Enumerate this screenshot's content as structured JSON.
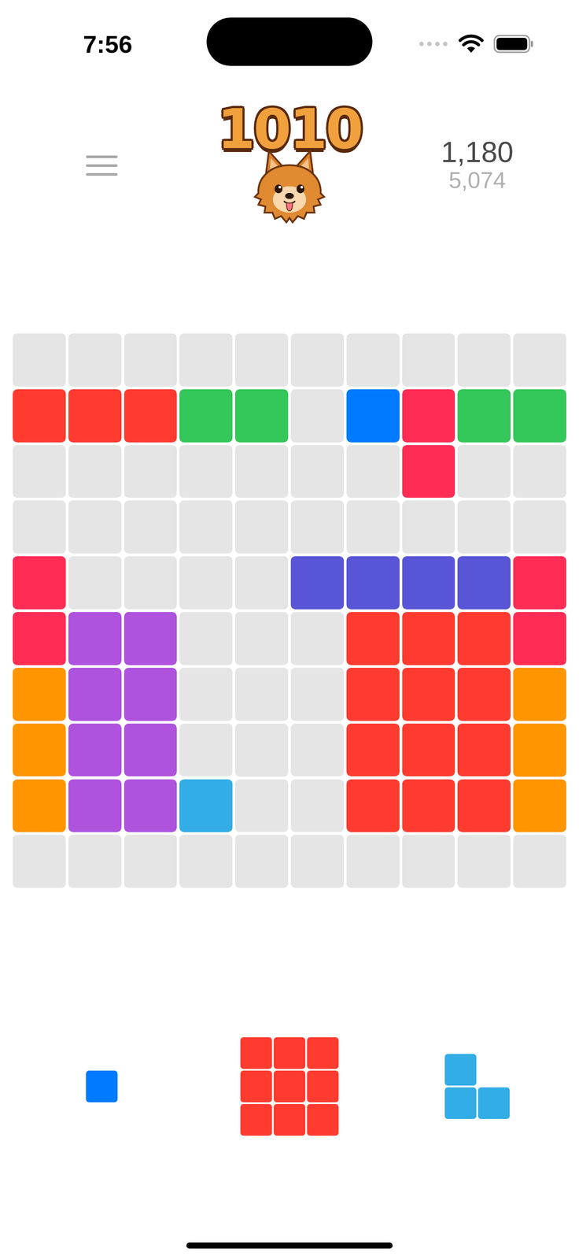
{
  "status_bar": {
    "time": "7:56"
  },
  "header": {
    "logo": "1010",
    "score": "1,180",
    "best": "5,074"
  },
  "board": {
    "rows": [
      [
        {
          "filled": false
        },
        {
          "filled": false
        },
        {
          "filled": false
        },
        {
          "filled": false
        },
        {
          "filled": false
        },
        {
          "filled": false
        },
        {
          "filled": false
        },
        {
          "filled": false
        },
        {
          "filled": false
        },
        {
          "filled": false
        }
      ],
      [
        {
          "filled": true,
          "color": "#FF3B30"
        },
        {
          "filled": true,
          "color": "#FF3B30"
        },
        {
          "filled": true,
          "color": "#FF3B30"
        },
        {
          "filled": true,
          "color": "#34C759"
        },
        {
          "filled": true,
          "color": "#34C759"
        },
        {
          "filled": false
        },
        {
          "filled": true,
          "color": "#007AFF"
        },
        {
          "filled": true,
          "color": "#FF2D55"
        },
        {
          "filled": true,
          "color": "#34C759"
        },
        {
          "filled": true,
          "color": "#34C759"
        }
      ],
      [
        {
          "filled": false
        },
        {
          "filled": false
        },
        {
          "filled": false
        },
        {
          "filled": false
        },
        {
          "filled": false
        },
        {
          "filled": false
        },
        {
          "filled": false
        },
        {
          "filled": true,
          "color": "#FF2D55"
        },
        {
          "filled": false
        },
        {
          "filled": false
        }
      ],
      [
        {
          "filled": false
        },
        {
          "filled": false
        },
        {
          "filled": false
        },
        {
          "filled": false
        },
        {
          "filled": false
        },
        {
          "filled": false
        },
        {
          "filled": false
        },
        {
          "filled": false
        },
        {
          "filled": false
        },
        {
          "filled": false
        }
      ],
      [
        {
          "filled": true,
          "color": "#FF2D55"
        },
        {
          "filled": false
        },
        {
          "filled": false
        },
        {
          "filled": false
        },
        {
          "filled": false
        },
        {
          "filled": true,
          "color": "#5856D6"
        },
        {
          "filled": true,
          "color": "#5856D6"
        },
        {
          "filled": true,
          "color": "#5856D6"
        },
        {
          "filled": true,
          "color": "#5856D6"
        },
        {
          "filled": true,
          "color": "#FF2D55"
        }
      ],
      [
        {
          "filled": true,
          "color": "#FF2D55"
        },
        {
          "filled": true,
          "color": "#AF52DE"
        },
        {
          "filled": true,
          "color": "#AF52DE"
        },
        {
          "filled": false
        },
        {
          "filled": false
        },
        {
          "filled": false
        },
        {
          "filled": true,
          "color": "#FF3B30"
        },
        {
          "filled": true,
          "color": "#FF3B30"
        },
        {
          "filled": true,
          "color": "#FF3B30"
        },
        {
          "filled": true,
          "color": "#FF2D55"
        }
      ],
      [
        {
          "filled": true,
          "color": "#FF9500"
        },
        {
          "filled": true,
          "color": "#AF52DE"
        },
        {
          "filled": true,
          "color": "#AF52DE"
        },
        {
          "filled": false
        },
        {
          "filled": false
        },
        {
          "filled": false
        },
        {
          "filled": true,
          "color": "#FF3B30"
        },
        {
          "filled": true,
          "color": "#FF3B30"
        },
        {
          "filled": true,
          "color": "#FF3B30"
        },
        {
          "filled": true,
          "color": "#FF9500"
        }
      ],
      [
        {
          "filled": true,
          "color": "#FF9500"
        },
        {
          "filled": true,
          "color": "#AF52DE"
        },
        {
          "filled": true,
          "color": "#AF52DE"
        },
        {
          "filled": false
        },
        {
          "filled": false
        },
        {
          "filled": false
        },
        {
          "filled": true,
          "color": "#FF3B30"
        },
        {
          "filled": true,
          "color": "#FF3B30"
        },
        {
          "filled": true,
          "color": "#FF3B30"
        },
        {
          "filled": true,
          "color": "#FF9500"
        }
      ],
      [
        {
          "filled": true,
          "color": "#FF9500"
        },
        {
          "filled": true,
          "color": "#AF52DE"
        },
        {
          "filled": true,
          "color": "#AF52DE"
        },
        {
          "filled": true,
          "color": "#32ADE6"
        },
        {
          "filled": false
        },
        {
          "filled": false
        },
        {
          "filled": true,
          "color": "#FF3B30"
        },
        {
          "filled": true,
          "color": "#FF3B30"
        },
        {
          "filled": true,
          "color": "#FF3B30"
        },
        {
          "filled": true,
          "color": "#FF9500"
        }
      ],
      [
        {
          "filled": false
        },
        {
          "filled": false
        },
        {
          "filled": false
        },
        {
          "filled": false
        },
        {
          "filled": false
        },
        {
          "filled": false
        },
        {
          "filled": false
        },
        {
          "filled": false
        },
        {
          "filled": false
        },
        {
          "filled": false
        }
      ]
    ]
  },
  "pieces": [
    {
      "color": "#007AFF",
      "cells": [
        [
          true
        ]
      ]
    },
    {
      "color": "#FF3B30",
      "cells": [
        [
          true,
          true,
          true
        ],
        [
          true,
          true,
          true
        ],
        [
          true,
          true,
          true
        ]
      ]
    },
    {
      "color": "#32ADE6",
      "cells": [
        [
          true,
          false
        ],
        [
          true,
          true
        ]
      ]
    }
  ]
}
